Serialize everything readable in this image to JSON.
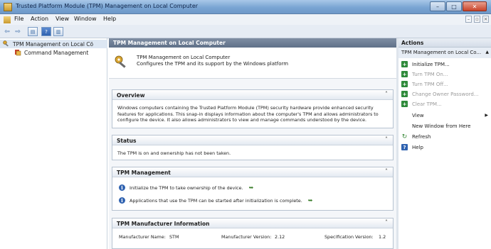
{
  "window": {
    "title": "Trusted Platform Module (TPM) Management on Local Computer",
    "buttons": {
      "minimize": "–",
      "maximize": "□",
      "close": "✕"
    }
  },
  "menu": {
    "items": [
      "File",
      "Action",
      "View",
      "Window",
      "Help"
    ],
    "mdi_minimize": "–",
    "mdi_restore": "▫",
    "mdi_close": "×"
  },
  "toolbar": {
    "back_icon": "⇦",
    "forward_icon": "⇨",
    "console_tree_icon": "▤",
    "help_icon": "?",
    "panel_icon": "▥"
  },
  "tree": {
    "root": "TPM Management on Local Cö",
    "child": "Command Management"
  },
  "center": {
    "header": "TPM Management on Local Computer",
    "intro_line1": "TPM Management on Local Computer",
    "intro_line2": "Configures the TPM and its support by the Windows platform",
    "overview": {
      "title": "Overview",
      "lines": [
        "Windows computers containing the Trusted Platform Module (TPM) security hardware provide enhanced security",
        "features for applications. This snap-in displays information about the computer's TPM and allows administrators to",
        "configure the device. It also allows administrators to view and manage commands understood by the device."
      ]
    },
    "status": {
      "title": "Status",
      "text": "The TPM is on and ownership has not been taken."
    },
    "management": {
      "title": "TPM Management",
      "items": [
        "Initialize the TPM to take ownership of the device.",
        "Applications that use the TPM can be started after initialization is complete."
      ]
    },
    "manufacturer": {
      "title": "TPM Manufacturer Information",
      "name_label": "Manufacturer Name:",
      "name_value": "STM",
      "version_label": "Manufacturer Version:",
      "version_value": "2.12",
      "spec_label": "Specification Version:",
      "spec_value": "1.2"
    },
    "caret": "˄"
  },
  "actions": {
    "header": "Actions",
    "subheader": "TPM Management on Local Co...",
    "subheader_arrow": "▲",
    "items": [
      {
        "label": "Initialize TPM...",
        "disabled": false
      },
      {
        "label": "Turn TPM On...",
        "disabled": true
      },
      {
        "label": "Turn TPM Off...",
        "disabled": true
      },
      {
        "label": "Change Owner Password...",
        "disabled": true
      },
      {
        "label": "Clear TPM...",
        "disabled": true
      },
      {
        "label": "View",
        "disabled": false
      },
      {
        "label": "New Window from Here",
        "disabled": false
      },
      {
        "label": "Refresh",
        "disabled": false
      },
      {
        "label": "Help",
        "disabled": false
      }
    ],
    "submenu_arrow": "▶",
    "help_icon_glyph": "?",
    "refresh_icon_glyph": "↻",
    "tpm_icon_glyph": "+"
  },
  "colors": {
    "accent": "#2f62b0",
    "action_green": "#2f8a3a",
    "header_gray": "#5f7088"
  }
}
